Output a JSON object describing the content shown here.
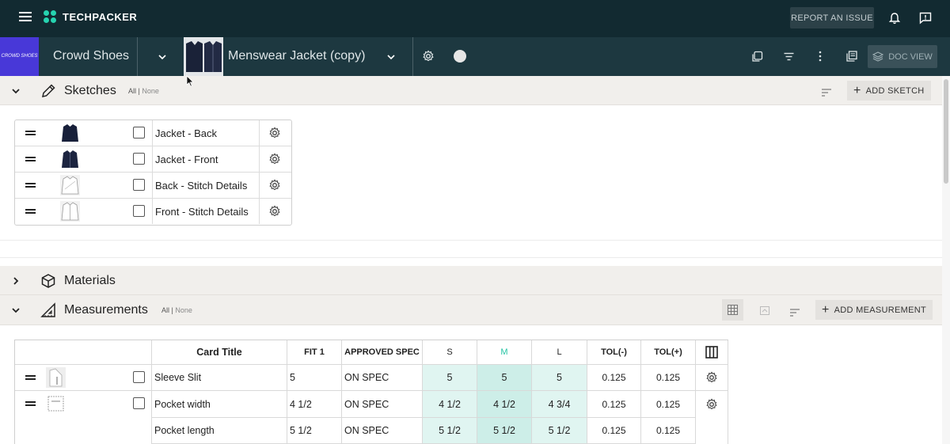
{
  "topbar": {
    "brand": "TECHPACKER",
    "report_label": "REPORT AN ISSUE"
  },
  "subbar": {
    "brand_logo_text": "CROWD SHOES",
    "project": "Crowd Shoes",
    "document": "Menswear Jacket (copy)",
    "docview_label": "DOC VIEW"
  },
  "sketches": {
    "title": "Sketches",
    "all": "All",
    "sep": "|",
    "none": "None",
    "add_label": "ADD SKETCH",
    "items": [
      {
        "name": "Jacket - Back"
      },
      {
        "name": "Jacket - Front"
      },
      {
        "name": "Back - Stitch Details"
      },
      {
        "name": "Front - Stitch Details"
      }
    ]
  },
  "materials": {
    "title": "Materials"
  },
  "measurements": {
    "title": "Measurements",
    "all": "All",
    "sep": "|",
    "none": "None",
    "add_label": "ADD MEASUREMENT",
    "columns": [
      "Card Title",
      "FIT 1",
      "APPROVED SPEC",
      "S",
      "M",
      "L",
      "TOL(-)",
      "TOL(+)"
    ],
    "rows": [
      {
        "title": "Sleeve Slit",
        "fit1": "5",
        "spec": "ON SPEC",
        "s": "5",
        "m": "5",
        "l": "5",
        "tolm": "0.125",
        "tolp": "0.125"
      },
      {
        "title": "Pocket width",
        "fit1": "4 1/2",
        "spec": "ON SPEC",
        "s": "4 1/2",
        "m": "4 1/2",
        "l": "4 3/4",
        "tolm": "0.125",
        "tolp": "0.125"
      },
      {
        "title": "Pocket length",
        "fit1": "5 1/2",
        "spec": "ON SPEC",
        "s": "5 1/2",
        "m": "5 1/2",
        "l": "5 1/2",
        "tolm": "0.125",
        "tolp": "0.125"
      }
    ]
  },
  "colors": {
    "topbar": "#122a31",
    "subbar": "#1d3840",
    "accent": "#26d3b0",
    "brand_logo": "#4838d8",
    "size_highlight": "#e0f5f1"
  },
  "icons": [
    "menu-icon",
    "bell-icon",
    "feedback-icon",
    "chevron-down-icon",
    "gear-icon",
    "copy-icon",
    "filter-icon",
    "more-icon",
    "pages-icon",
    "layers-icon",
    "pencil-icon",
    "box-icon",
    "ruler-triangle-icon",
    "grid-icon",
    "columns-icon",
    "drag-handle-icon",
    "sort-icon"
  ]
}
